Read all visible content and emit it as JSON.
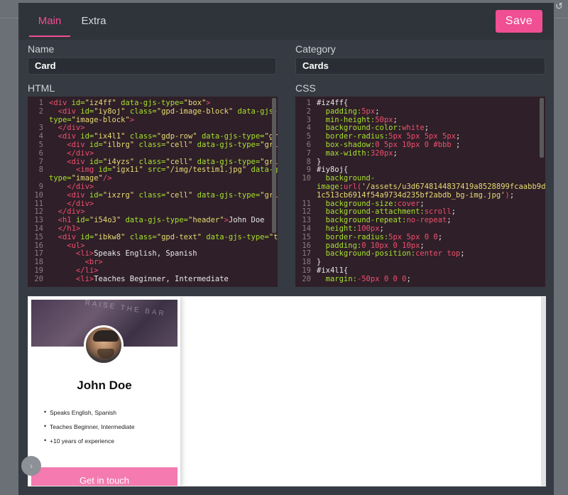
{
  "modal": {
    "tabs": [
      {
        "label": "Main"
      },
      {
        "label": "Extra"
      }
    ],
    "save_label": "Save"
  },
  "fields": {
    "name_label": "Name",
    "name_value": "Card",
    "category_label": "Category",
    "category_value": "Cards",
    "html_label": "HTML",
    "css_label": "CSS"
  },
  "html_lines": [
    {
      "n": "1",
      "parts": [
        [
          "tag",
          "<div "
        ],
        [
          "attr",
          "id="
        ],
        [
          "str",
          "\"iz4ff\" "
        ],
        [
          "attr",
          "data-gjs-type="
        ],
        [
          "str",
          "\"box\""
        ],
        [
          "tag",
          ">"
        ]
      ]
    },
    {
      "n": "2",
      "parts": [
        [
          "tag",
          "  <div "
        ],
        [
          "attr",
          "id="
        ],
        [
          "str",
          "\"iy8oj\" "
        ],
        [
          "attr",
          "class="
        ],
        [
          "str",
          "\"gpd-image-block\" "
        ],
        [
          "attr",
          "data-gjs-"
        ]
      ]
    },
    {
      "n": "",
      "parts": [
        [
          "attr",
          "type="
        ],
        [
          "str",
          "\"image-block\""
        ],
        [
          "tag",
          ">"
        ]
      ]
    },
    {
      "n": "3",
      "parts": [
        [
          "tag",
          "  </div>"
        ]
      ]
    },
    {
      "n": "4",
      "parts": [
        [
          "tag",
          "  <div "
        ],
        [
          "attr",
          "id="
        ],
        [
          "str",
          "\"ix4l1\" "
        ],
        [
          "attr",
          "class="
        ],
        [
          "str",
          "\"gdp-row\" "
        ],
        [
          "attr",
          "data-gjs-type="
        ],
        [
          "str",
          "\"grid-row\""
        ],
        [
          "tag",
          ">"
        ]
      ]
    },
    {
      "n": "5",
      "parts": [
        [
          "tag",
          "    <div "
        ],
        [
          "attr",
          "id="
        ],
        [
          "str",
          "\"ilbrg\" "
        ],
        [
          "attr",
          "class="
        ],
        [
          "str",
          "\"cell\" "
        ],
        [
          "attr",
          "data-gjs-type="
        ],
        [
          "str",
          "\"grid-item\""
        ],
        [
          "tag",
          ">"
        ]
      ]
    },
    {
      "n": "6",
      "parts": [
        [
          "tag",
          "    </div>"
        ]
      ]
    },
    {
      "n": "7",
      "parts": [
        [
          "tag",
          "    <div "
        ],
        [
          "attr",
          "id="
        ],
        [
          "str",
          "\"i4yzs\" "
        ],
        [
          "attr",
          "class="
        ],
        [
          "str",
          "\"cell\" "
        ],
        [
          "attr",
          "data-gjs-type="
        ],
        [
          "str",
          "\"grid-item\""
        ],
        [
          "tag",
          ">"
        ]
      ]
    },
    {
      "n": "8",
      "parts": [
        [
          "tag",
          "      <img "
        ],
        [
          "attr",
          "id="
        ],
        [
          "str",
          "\"igx1i\" "
        ],
        [
          "attr",
          "src="
        ],
        [
          "str",
          "\"/img/testim1.jpg\" "
        ],
        [
          "attr",
          "data-gjs-"
        ]
      ]
    },
    {
      "n": "",
      "parts": [
        [
          "attr",
          "type="
        ],
        [
          "str",
          "\"image\""
        ],
        [
          "tag",
          "/>"
        ]
      ]
    },
    {
      "n": "9",
      "parts": [
        [
          "tag",
          "    </div>"
        ]
      ]
    },
    {
      "n": "10",
      "parts": [
        [
          "tag",
          "    <div "
        ],
        [
          "attr",
          "id="
        ],
        [
          "str",
          "\"ixzrg\" "
        ],
        [
          "attr",
          "class="
        ],
        [
          "str",
          "\"cell\" "
        ],
        [
          "attr",
          "data-gjs-type="
        ],
        [
          "str",
          "\"grid-item\""
        ],
        [
          "tag",
          ">"
        ]
      ]
    },
    {
      "n": "11",
      "parts": [
        [
          "tag",
          "    </div>"
        ]
      ]
    },
    {
      "n": "12",
      "parts": [
        [
          "tag",
          "  </div>"
        ]
      ]
    },
    {
      "n": "13",
      "parts": [
        [
          "tag",
          "  <h1 "
        ],
        [
          "attr",
          "id="
        ],
        [
          "str",
          "\"i54o3\" "
        ],
        [
          "attr",
          "data-gjs-type="
        ],
        [
          "str",
          "\"header\""
        ],
        [
          "tag",
          ">"
        ],
        [
          "txt",
          "John Doe"
        ]
      ]
    },
    {
      "n": "14",
      "parts": [
        [
          "tag",
          "  </h1>"
        ]
      ]
    },
    {
      "n": "15",
      "parts": [
        [
          "tag",
          "  <div "
        ],
        [
          "attr",
          "id="
        ],
        [
          "str",
          "\"ibkw8\" "
        ],
        [
          "attr",
          "class="
        ],
        [
          "str",
          "\"gpd-text\" "
        ],
        [
          "attr",
          "data-gjs-type="
        ],
        [
          "str",
          "\"text\""
        ],
        [
          "tag",
          ">"
        ]
      ]
    },
    {
      "n": "16",
      "parts": [
        [
          "tag",
          "    <ul>"
        ]
      ]
    },
    {
      "n": "17",
      "parts": [
        [
          "tag",
          "      <li>"
        ],
        [
          "txt",
          "Speaks English, Spanish"
        ]
      ]
    },
    {
      "n": "18",
      "parts": [
        [
          "tag",
          "        <br>"
        ]
      ]
    },
    {
      "n": "19",
      "parts": [
        [
          "tag",
          "      </li>"
        ]
      ]
    },
    {
      "n": "20",
      "parts": [
        [
          "tag",
          "      <li>"
        ],
        [
          "txt",
          "Teaches Beginner, Intermediate"
        ]
      ]
    }
  ],
  "css_lines": [
    {
      "n": "1",
      "parts": [
        [
          "sel",
          "#iz4ff{"
        ]
      ]
    },
    {
      "n": "2",
      "parts": [
        [
          "prop",
          "  padding:"
        ],
        [
          "val",
          "5px"
        ],
        [
          "sel",
          ";"
        ]
      ]
    },
    {
      "n": "3",
      "parts": [
        [
          "prop",
          "  min-height:"
        ],
        [
          "val",
          "50px"
        ],
        [
          "sel",
          ";"
        ]
      ]
    },
    {
      "n": "4",
      "parts": [
        [
          "prop",
          "  background-color:"
        ],
        [
          "val",
          "white"
        ],
        [
          "sel",
          ";"
        ]
      ]
    },
    {
      "n": "5",
      "parts": [
        [
          "prop",
          "  border-radius:"
        ],
        [
          "val",
          "5px 5px 5px 5px"
        ],
        [
          "sel",
          ";"
        ]
      ]
    },
    {
      "n": "6",
      "parts": [
        [
          "prop",
          "  box-shadow:"
        ],
        [
          "val",
          "0 5px 10px 0 #bbb "
        ],
        [
          "sel",
          ";"
        ]
      ]
    },
    {
      "n": "7",
      "parts": [
        [
          "prop",
          "  max-width:"
        ],
        [
          "val",
          "320px"
        ],
        [
          "sel",
          ";"
        ]
      ]
    },
    {
      "n": "8",
      "parts": [
        [
          "sel",
          "}"
        ]
      ]
    },
    {
      "n": "9",
      "parts": [
        [
          "sel",
          "#iy8oj{"
        ]
      ]
    },
    {
      "n": "10",
      "parts": [
        [
          "prop",
          "  background-"
        ]
      ]
    },
    {
      "n": "",
      "parts": [
        [
          "prop",
          "image:"
        ],
        [
          "val",
          "url("
        ],
        [
          "url",
          "'/assets/u3d6748144837419a8528899fcaabb9df/2a"
        ]
      ]
    },
    {
      "n": "",
      "parts": [
        [
          "url",
          "1c513cb6914f54a9734d235bf2abdb_bg-img.jpg'"
        ],
        [
          "val",
          ")"
        ],
        [
          "sel",
          ";"
        ]
      ]
    },
    {
      "n": "11",
      "parts": [
        [
          "prop",
          "  background-size:"
        ],
        [
          "val",
          "cover"
        ],
        [
          "sel",
          ";"
        ]
      ]
    },
    {
      "n": "12",
      "parts": [
        [
          "prop",
          "  background-attachment:"
        ],
        [
          "val",
          "scroll"
        ],
        [
          "sel",
          ";"
        ]
      ]
    },
    {
      "n": "13",
      "parts": [
        [
          "prop",
          "  background-repeat:"
        ],
        [
          "val",
          "no-repeat"
        ],
        [
          "sel",
          ";"
        ]
      ]
    },
    {
      "n": "14",
      "parts": [
        [
          "prop",
          "  height:"
        ],
        [
          "val",
          "100px"
        ],
        [
          "sel",
          ";"
        ]
      ]
    },
    {
      "n": "15",
      "parts": [
        [
          "prop",
          "  border-radius:"
        ],
        [
          "val",
          "5px 5px 0 0"
        ],
        [
          "sel",
          ";"
        ]
      ]
    },
    {
      "n": "16",
      "parts": [
        [
          "prop",
          "  padding:"
        ],
        [
          "val",
          "0 10px 0 10px"
        ],
        [
          "sel",
          ";"
        ]
      ]
    },
    {
      "n": "17",
      "parts": [
        [
          "prop",
          "  background-position:"
        ],
        [
          "val",
          "center top"
        ],
        [
          "sel",
          ";"
        ]
      ]
    },
    {
      "n": "18",
      "parts": [
        [
          "sel",
          "}"
        ]
      ]
    },
    {
      "n": "19",
      "parts": [
        [
          "sel",
          "#ix4l1{"
        ]
      ]
    },
    {
      "n": "20",
      "parts": [
        [
          "prop",
          "  margin:"
        ],
        [
          "val",
          "-50px 0 0 0"
        ],
        [
          "sel",
          ";"
        ]
      ]
    }
  ],
  "preview": {
    "banner_watermark": "RAISE THE BAR",
    "name": "John Doe",
    "list": [
      "Speaks English, Spanish",
      "Teaches Beginner, Intermediate",
      "+10 years of experience"
    ],
    "cta_label": "Get in touch"
  },
  "icons": {
    "undo": "undo-icon",
    "handle": "chevron-right-icon"
  },
  "colors": {
    "accent": "#f04f93",
    "editor_bg": "#2f1f28",
    "modal_bg": "#363a42"
  }
}
